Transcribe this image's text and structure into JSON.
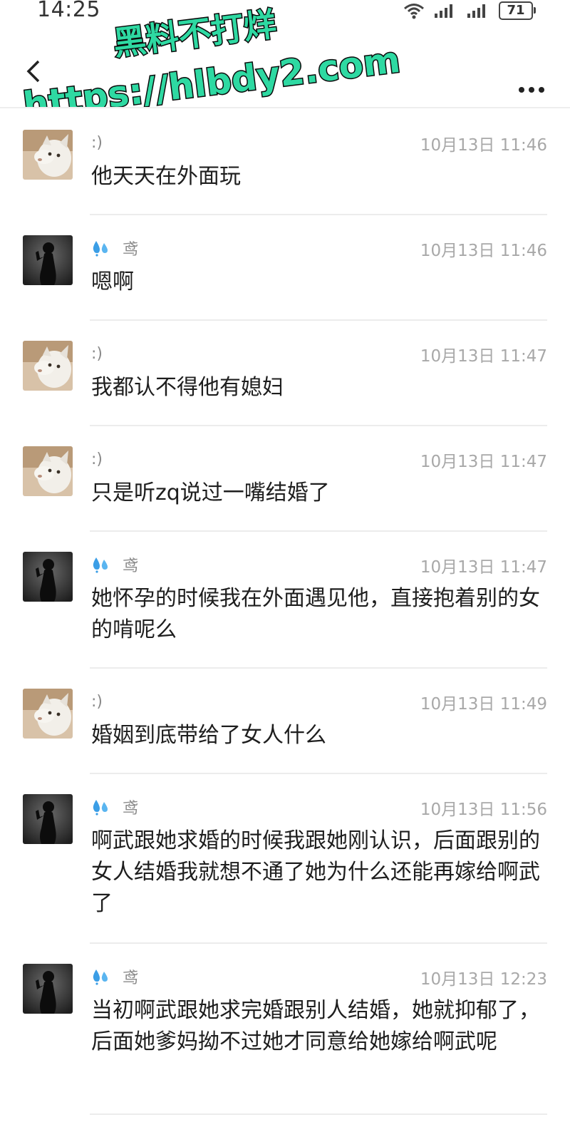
{
  "status_bar": {
    "time": "14:25",
    "battery": "71"
  },
  "watermark": {
    "line1": "黑料不打烊",
    "line2": "https://hlbdy2.com"
  },
  "messages": [
    {
      "sender": ":)",
      "avatar": "cat-avatar",
      "has_badge": false,
      "time": "10月13日 11:46",
      "text": "他天天在外面玩"
    },
    {
      "sender": "鸢",
      "avatar": "silhouette-avatar",
      "has_badge": true,
      "time": "10月13日 11:46",
      "text": "嗯啊"
    },
    {
      "sender": ":)",
      "avatar": "cat-avatar",
      "has_badge": false,
      "time": "10月13日 11:47",
      "text": "我都认不得他有媳妇"
    },
    {
      "sender": ":)",
      "avatar": "cat-avatar",
      "has_badge": false,
      "time": "10月13日 11:47",
      "text": "只是听zq说过一嘴结婚了"
    },
    {
      "sender": "鸢",
      "avatar": "silhouette-avatar",
      "has_badge": true,
      "time": "10月13日 11:47",
      "text": "她怀孕的时候我在外面遇见他，直接抱着别的女的啃呢么"
    },
    {
      "sender": ":)",
      "avatar": "cat-avatar",
      "has_badge": false,
      "time": "10月13日 11:49",
      "text": "婚姻到底带给了女人什么"
    },
    {
      "sender": "鸢",
      "avatar": "silhouette-avatar",
      "has_badge": true,
      "time": "10月13日 11:56",
      "text": "啊武跟她求婚的时候我跟她刚认识，后面跟别的女人结婚我就想不通了她为什么还能再嫁给啊武了"
    },
    {
      "sender": "鸢",
      "avatar": "silhouette-avatar",
      "has_badge": true,
      "time": "10月13日 12:23",
      "text": "当初啊武跟她求完婚跟别人结婚，她就抑郁了，后面她爹妈拗不过她才同意给她嫁给啊武呢"
    }
  ]
}
